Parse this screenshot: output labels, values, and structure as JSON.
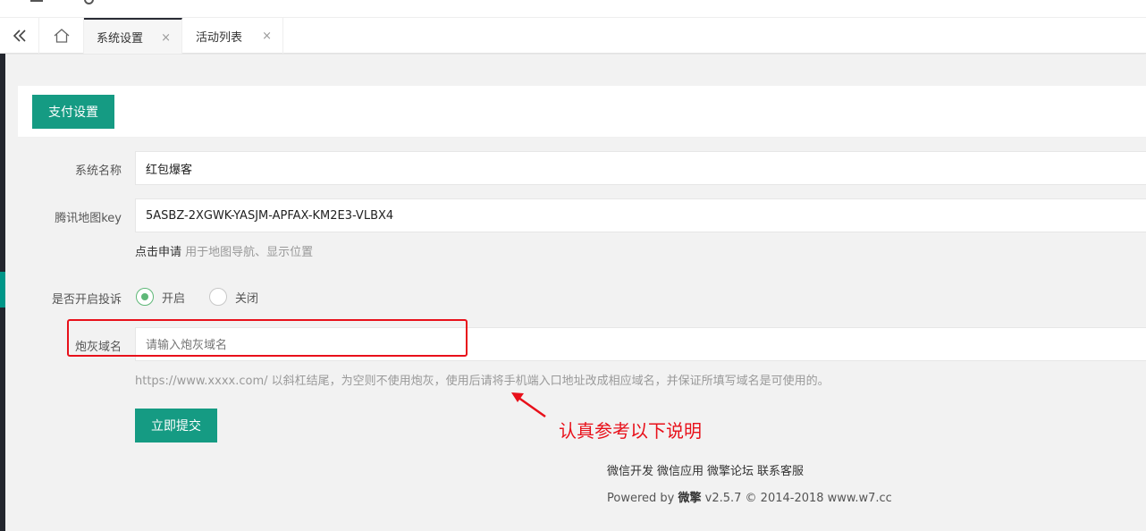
{
  "tabs": {
    "items": [
      {
        "label": "系统设置",
        "active": true
      },
      {
        "label": "活动列表",
        "active": false
      }
    ],
    "close_glyph": "×"
  },
  "header": {
    "pay_settings_label": "支付设置"
  },
  "form": {
    "system_name": {
      "label": "系统名称",
      "value": "红包爆客"
    },
    "map_key": {
      "label": "腾讯地图key",
      "value": "5ASBZ-2XGWK-YASJM-APFAX-KM2E3-VLBX4"
    },
    "map_hint": {
      "link": "点击申请",
      "text": " 用于地图导航、显示位置"
    },
    "complaint": {
      "label": "是否开启投诉",
      "options": [
        {
          "label": "开启",
          "checked": true
        },
        {
          "label": "关闭",
          "checked": false
        }
      ]
    },
    "cannon_domain": {
      "label": "炮灰域名",
      "placeholder": "请输入炮灰域名",
      "value": ""
    },
    "domain_hint": "https://www.xxxx.com/ 以斜杠结尾，为空则不使用炮灰，使用后请将手机端入口地址改成相应域名，并保证所填写域名是可使用的。",
    "submit_label": "立即提交"
  },
  "annotation": {
    "text": "认真参考以下说明",
    "color": "#e8101a"
  },
  "footer": {
    "links": [
      "微信开发",
      "微信应用",
      "微擎论坛",
      "联系客服"
    ],
    "powered_prefix": "Powered by ",
    "brand": "微擎",
    "version_text": " v2.5.7 © 2014-2018 www.w7.cc"
  },
  "colors": {
    "primary_button": "#159b83",
    "radio_checked": "#5fb878",
    "sidebar": "#23262e",
    "sidebar_accent": "#009688"
  },
  "icons": {
    "collapse": "double-chevron-left-icon",
    "home": "home-icon",
    "tab_close": "close-icon"
  }
}
